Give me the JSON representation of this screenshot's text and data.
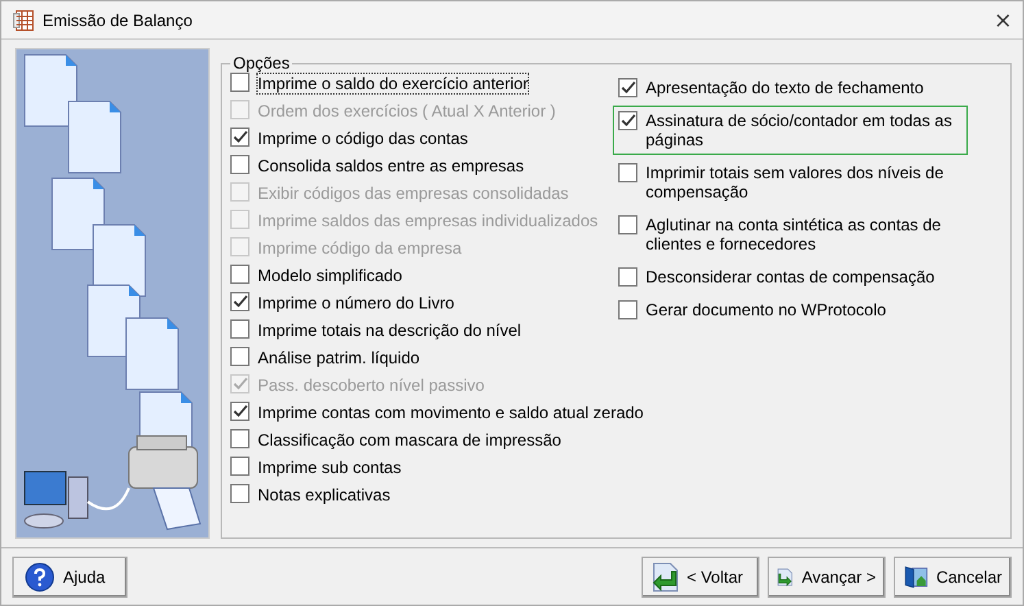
{
  "window": {
    "title": "Emissão de Balanço",
    "close": "⨯"
  },
  "options_group": {
    "title": "Opções",
    "left": [
      {
        "label": "Imprime o saldo do exercício anterior",
        "checked": false,
        "disabled": false,
        "focused": true
      },
      {
        "label": "Ordem dos exercícios ( Atual X Anterior )",
        "checked": false,
        "disabled": true,
        "focused": false
      },
      {
        "label": "Imprime o código das contas",
        "checked": true,
        "disabled": false,
        "focused": false
      },
      {
        "label": "Consolida saldos entre as empresas",
        "checked": false,
        "disabled": false,
        "focused": false
      },
      {
        "label": "Exibir códigos das empresas consolidadas",
        "checked": false,
        "disabled": true,
        "focused": false
      },
      {
        "label": "Imprime saldos das empresas individualizados",
        "checked": false,
        "disabled": true,
        "focused": false
      },
      {
        "label": "Imprime código da empresa",
        "checked": false,
        "disabled": true,
        "focused": false
      },
      {
        "label": "Modelo simplificado",
        "checked": false,
        "disabled": false,
        "focused": false
      },
      {
        "label": "Imprime o número do Livro",
        "checked": true,
        "disabled": false,
        "focused": false
      },
      {
        "label": "Imprime totais na descrição do nível",
        "checked": false,
        "disabled": false,
        "focused": false
      },
      {
        "label": "Análise patrim. líquido",
        "checked": false,
        "disabled": false,
        "focused": false
      },
      {
        "label": "Pass. descoberto nível passivo",
        "checked": true,
        "disabled": true,
        "focused": false
      },
      {
        "label": "Imprime contas com movimento e saldo atual zerado",
        "checked": true,
        "disabled": false,
        "focused": false
      },
      {
        "label": "Classificação com mascara de impressão",
        "checked": false,
        "disabled": false,
        "focused": false
      },
      {
        "label": "Imprime sub contas",
        "checked": false,
        "disabled": false,
        "focused": false
      },
      {
        "label": "Notas explicativas",
        "checked": false,
        "disabled": false,
        "focused": false
      }
    ],
    "right": [
      {
        "label": "Apresentação do texto de fechamento",
        "checked": true,
        "highlighted": false
      },
      {
        "label": "Assinatura de sócio/contador em todas as páginas",
        "checked": true,
        "highlighted": true
      },
      {
        "label": "Imprimir totais sem valores dos níveis de compensação",
        "checked": false,
        "highlighted": false
      },
      {
        "label": "Aglutinar na conta sintética as contas de clientes e fornecedores",
        "checked": false,
        "highlighted": false
      },
      {
        "label": "Desconsiderar contas de compensação",
        "checked": false,
        "highlighted": false
      },
      {
        "label": "Gerar documento no WProtocolo",
        "checked": false,
        "highlighted": false
      }
    ]
  },
  "buttons": [
    {
      "label": "Ajuda",
      "kind": "help"
    },
    {
      "label": "< Voltar",
      "kind": "back"
    },
    {
      "label": "Avançar >",
      "kind": "next"
    },
    {
      "label": "Cancelar",
      "kind": "cancel"
    }
  ]
}
